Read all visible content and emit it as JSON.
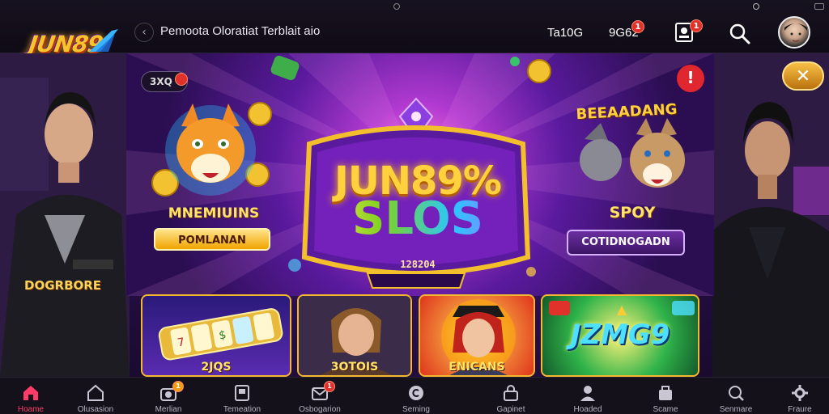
{
  "brand": {
    "logo_text": "JUN89"
  },
  "topbar": {
    "announcement": "Pemoota Oloratiat Terblait aio",
    "counter_left": "Ta10G",
    "counter_right": "9G62",
    "notifications": {
      "count": "1"
    },
    "messages": {
      "count": "1"
    },
    "profile_badge": {
      "count": "1"
    }
  },
  "banner": {
    "pill_label": "3XQ",
    "alert_label": "!",
    "title": "JUN89%",
    "subtitle": "SLOS",
    "number": "128204",
    "left_promo": {
      "title": "MNEMIUINS",
      "button": "POMLANAN"
    },
    "right_promo": {
      "heading": "BEEAADANG",
      "title": "SPOY",
      "button": "COTIDNOGADN"
    }
  },
  "side_left": {
    "caption": "DOGRBORE"
  },
  "close_button_label": "✕",
  "cards": [
    {
      "label": "2JQS"
    },
    {
      "label": "3OTOIS"
    },
    {
      "label": "ENICANS"
    },
    {
      "label": "",
      "title": "JZMG9"
    }
  ],
  "bottom_nav": [
    {
      "label": "Hoame",
      "icon": "home-icon",
      "active": true
    },
    {
      "label": "Olusasion",
      "icon": "house-outline-icon"
    },
    {
      "label": "Merlian",
      "icon": "camera-icon",
      "badge": "1"
    },
    {
      "label": "Temeation",
      "icon": "bookmark-icon"
    },
    {
      "label": "Osbogarion",
      "icon": "mail-icon",
      "badge": "1"
    },
    {
      "label": "Seming",
      "icon": "circle-c-icon"
    },
    {
      "label": "Gapinet",
      "icon": "lock-icon"
    },
    {
      "label": "Hoaded",
      "icon": "user-icon"
    },
    {
      "label": "Scame",
      "icon": "bag-icon"
    },
    {
      "label": "Senmare",
      "icon": "search-icon"
    },
    {
      "label": "Fraure",
      "icon": "gear-icon"
    }
  ],
  "colors": {
    "accent_gold": "#f7c52b",
    "accent_red": "#e0322b",
    "active_nav": "#ff3b6a",
    "bg_purple": "#5b1e8f"
  }
}
